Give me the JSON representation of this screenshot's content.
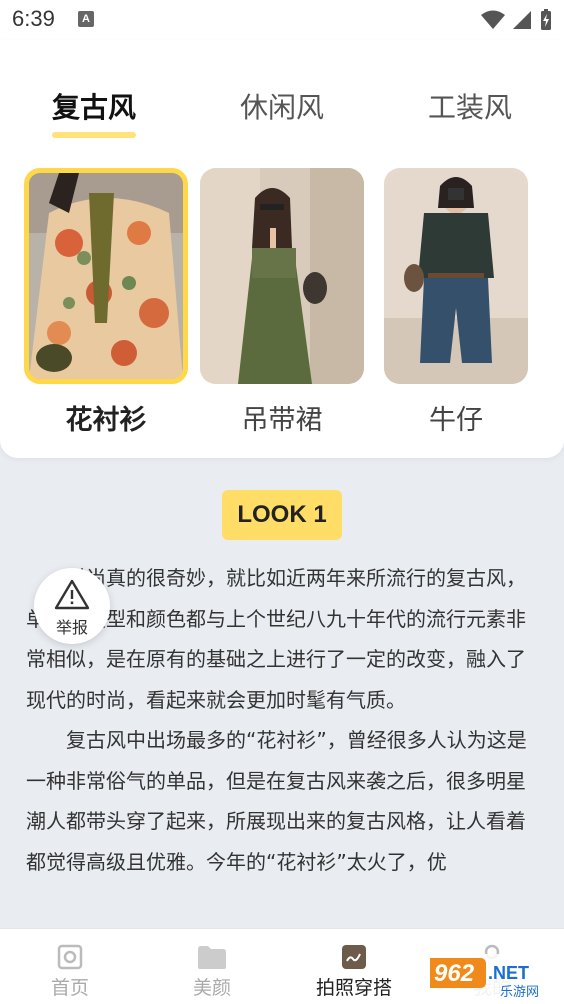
{
  "status_bar": {
    "time": "6:39",
    "badge": "A"
  },
  "tabs": [
    {
      "label": "复古风",
      "active": true
    },
    {
      "label": "休闲风",
      "active": false
    },
    {
      "label": "工装风",
      "active": false
    }
  ],
  "style_cards": [
    {
      "label": "花衬衫",
      "selected": true
    },
    {
      "label": "吊带裙",
      "selected": false
    },
    {
      "label": "牛仔",
      "selected": false
    }
  ],
  "look_badge": "LOOK 1",
  "report_button": {
    "label": "举报"
  },
  "article": {
    "paragraphs": [
      "时尚真的很奇妙，就比如近两年来所流行的复古风，单品的版型和颜色都与上个世纪八九十年代的流行元素非常相似，是在原有的基础之上进行了一定的改变，融入了现代的时尚，看起来就会更加时髦有气质。",
      "复古风中出场最多的“花衬衫”，曾经很多人认为这是一种非常俗气的单品，但是在复古风来袭之后，很多明星潮人都带头穿了起来，所展现出来的复古风格，让人看着都觉得高级且优雅。今年的“花衬衫”太火了，优"
    ]
  },
  "bottom_nav": [
    {
      "label": "首页",
      "icon": "home-icon",
      "active": false
    },
    {
      "label": "美颜",
      "icon": "folder-icon",
      "active": false
    },
    {
      "label": "拍照穿搭",
      "icon": "outfit-icon",
      "active": true
    },
    {
      "label": "我的",
      "icon": "profile-icon",
      "active": false
    }
  ],
  "watermark": {
    "text": "962.NET",
    "subtext": "乐游网"
  },
  "colors": {
    "accent": "#ffdd66",
    "underline": "#ffe27a",
    "background": "#e9edf2"
  }
}
